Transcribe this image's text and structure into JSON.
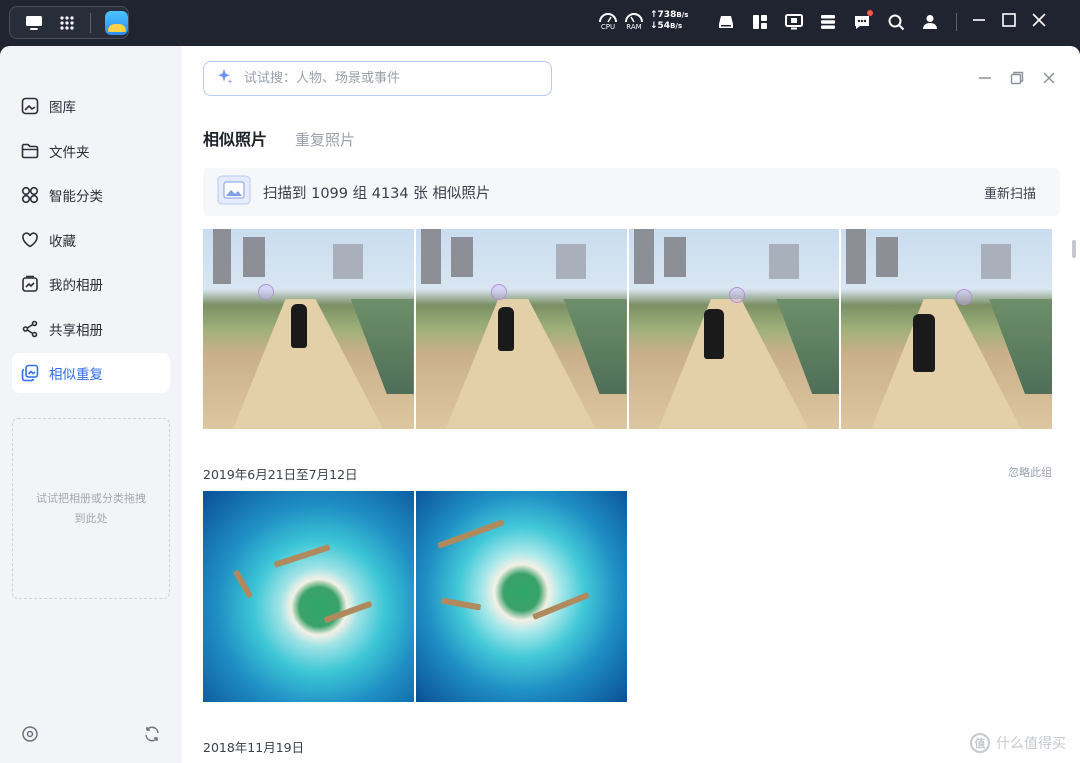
{
  "topbar": {
    "cpu_label": "CPU",
    "ram_label": "RAM",
    "upload": "738",
    "upload_unit": "B/s",
    "download": "54",
    "download_unit": "B/s"
  },
  "search": {
    "placeholder": "试试搜：人物、场景或事件"
  },
  "sidebar": {
    "items": [
      {
        "label": "图库",
        "icon": "gallery-icon"
      },
      {
        "label": "文件夹",
        "icon": "folder-icon"
      },
      {
        "label": "智能分类",
        "icon": "grid-icon"
      },
      {
        "label": "收藏",
        "icon": "heart-icon"
      },
      {
        "label": "我的相册",
        "icon": "album-icon"
      },
      {
        "label": "共享相册",
        "icon": "share-icon"
      },
      {
        "label": "相似重复",
        "icon": "duplicate-icon",
        "active": true
      }
    ],
    "dropzone_text": "试试把相册或分类拖拽到此处"
  },
  "tabs": [
    {
      "label": "相似照片",
      "active": true
    },
    {
      "label": "重复照片",
      "active": false
    }
  ],
  "banner": {
    "text": "扫描到 1099 组 4134 张 相似照片",
    "rescan": "重新扫描"
  },
  "groups": [
    {
      "date": "2019年6月21日至7月12日",
      "ignore": "忽略此组"
    },
    {
      "date": "2018年11月19日"
    }
  ],
  "watermark": {
    "mark": "值",
    "text": "什么值得买"
  },
  "colors": {
    "accent": "#2f6ff0",
    "topbar": "#1f2430",
    "sidebar": "#f3f4f7"
  }
}
